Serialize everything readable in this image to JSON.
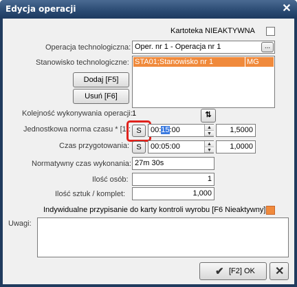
{
  "window": {
    "title": "Edycja operacji",
    "close_icon": "close-icon"
  },
  "inactive": {
    "label": "Kartoteka NIEAKTYWNA",
    "checked": false
  },
  "operation": {
    "label": "Operacja technologiczna:",
    "value": "Oper. nr 1 - Operacja nr 1",
    "browse_label": "..."
  },
  "workstation": {
    "label": "Stanowisko technologiczne:",
    "rows": [
      {
        "name": "STA01;Stanowisko nr 1",
        "code": "MG"
      }
    ],
    "add_label": "Dodaj [F5]",
    "remove_label": "Usuń [F6]"
  },
  "order": {
    "label": "Kolejność wykonywania operacji:",
    "value": "1"
  },
  "unit_time": {
    "label": "Jednostkowa norma czasu * [1]:",
    "s_label": "S",
    "time_prefix": "00:",
    "time_selected": "15",
    "time_suffix": ":00",
    "factor": "1,5000"
  },
  "prep_time": {
    "label": "Czas przygotowania:",
    "s_label": "S",
    "time": "00:05:00",
    "factor": "1,0000"
  },
  "normative": {
    "label": "Normatywny czas wykonania:",
    "value": "27m 30s"
  },
  "persons": {
    "label": "Ilość osób:",
    "value": "1"
  },
  "pieces": {
    "label": "Ilość sztuk / komplet:",
    "value": "1,000"
  },
  "individual": {
    "label": "Indywidualne przypisanie do karty kontroli wyrobu [F6 Nieaktywny]:",
    "color": "#f08a3c"
  },
  "remarks": {
    "label": "Uwagi:",
    "value": ""
  },
  "footer": {
    "ok_label": "[F2] OK",
    "check_icon": "check-icon",
    "cancel_icon": "cancel-icon"
  }
}
